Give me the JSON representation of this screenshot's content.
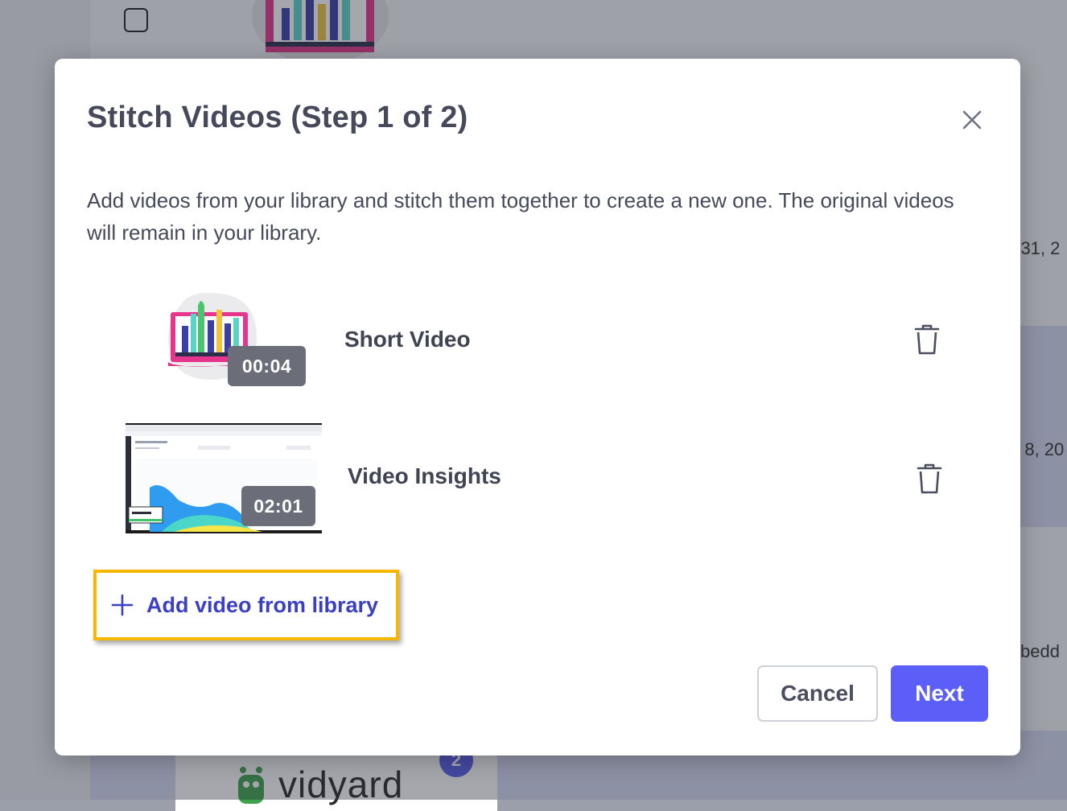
{
  "background": {
    "date_1": "r 31, 2",
    "date_2": "b 8, 20",
    "embed_text": "bedd",
    "notification_count": "2",
    "logo_text": "vidyard"
  },
  "modal": {
    "title": "Stitch Videos (Step 1 of 2)",
    "description": "Add videos from your library and stitch them together to create a new one. The original videos will remain in your library.",
    "close_icon": "close-icon",
    "videos": [
      {
        "title": "Short Video",
        "duration": "00:04",
        "delete_icon": "trash-icon"
      },
      {
        "title": "Video Insights",
        "duration": "02:01",
        "delete_icon": "trash-icon"
      }
    ],
    "add_button_label": "Add video from library",
    "cancel_label": "Cancel",
    "next_label": "Next"
  },
  "colors": {
    "accent": "#5b5ff7",
    "link": "#3b3fc4",
    "highlight_border": "#f5b700",
    "text": "#45495a"
  }
}
